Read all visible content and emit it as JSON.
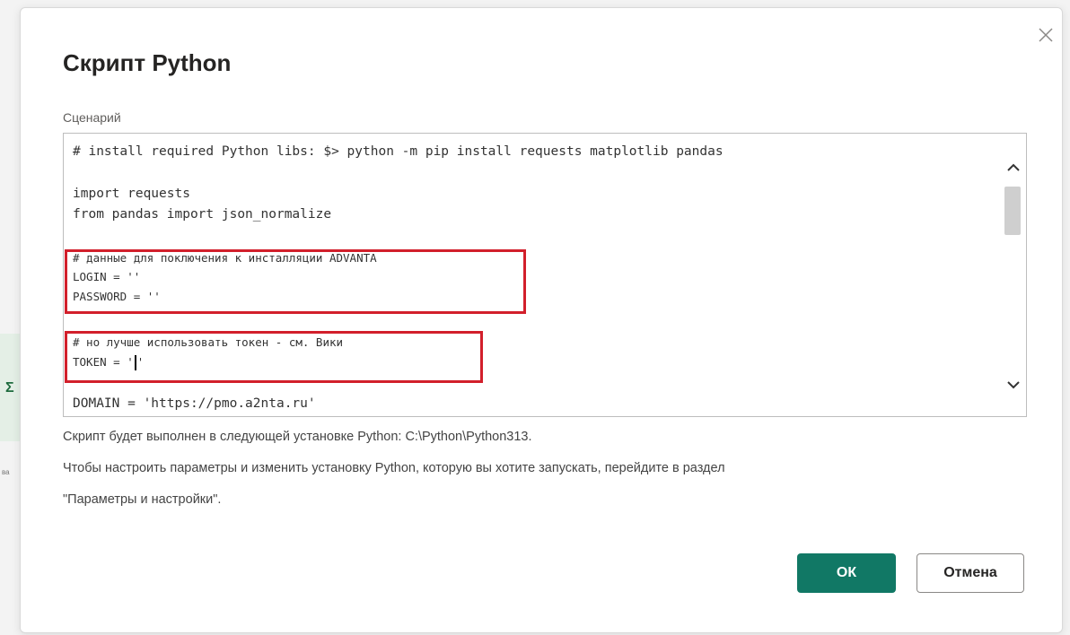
{
  "dialog": {
    "title": "Скрипт Python",
    "field_label": "Сценарий",
    "code_lines": [
      "# install required Python libs: $> python -m pip install requests matplotlib pandas",
      "import requests",
      "from pandas import json_normalize",
      "# данные для поключения к инсталляции ADVANTA",
      "LOGIN = ''",
      "PASSWORD = ''",
      "# но лучше использовать токен - см. Вики",
      "TOKEN = '",
      "'",
      "DOMAIN = 'https://pmo.a2nta.ru'"
    ],
    "info_line1": "Скрипт будет выполнен в следующей установке Python: C:\\Python\\Python313.",
    "info_line2": "Чтобы настроить параметры и изменить установку Python, которую вы хотите запускать, перейдите в раздел",
    "info_line3": "\"Параметры и настройки\".",
    "ok_label": "ОК",
    "cancel_label": "Отмена"
  },
  "background": {
    "visible_glyph": "Σ",
    "visible_dots": "ва"
  },
  "colors": {
    "primary_button": "#117865",
    "highlight_box": "#d21f2b"
  },
  "icons": [
    "close-icon",
    "chevron-up-icon",
    "chevron-down-icon"
  ]
}
